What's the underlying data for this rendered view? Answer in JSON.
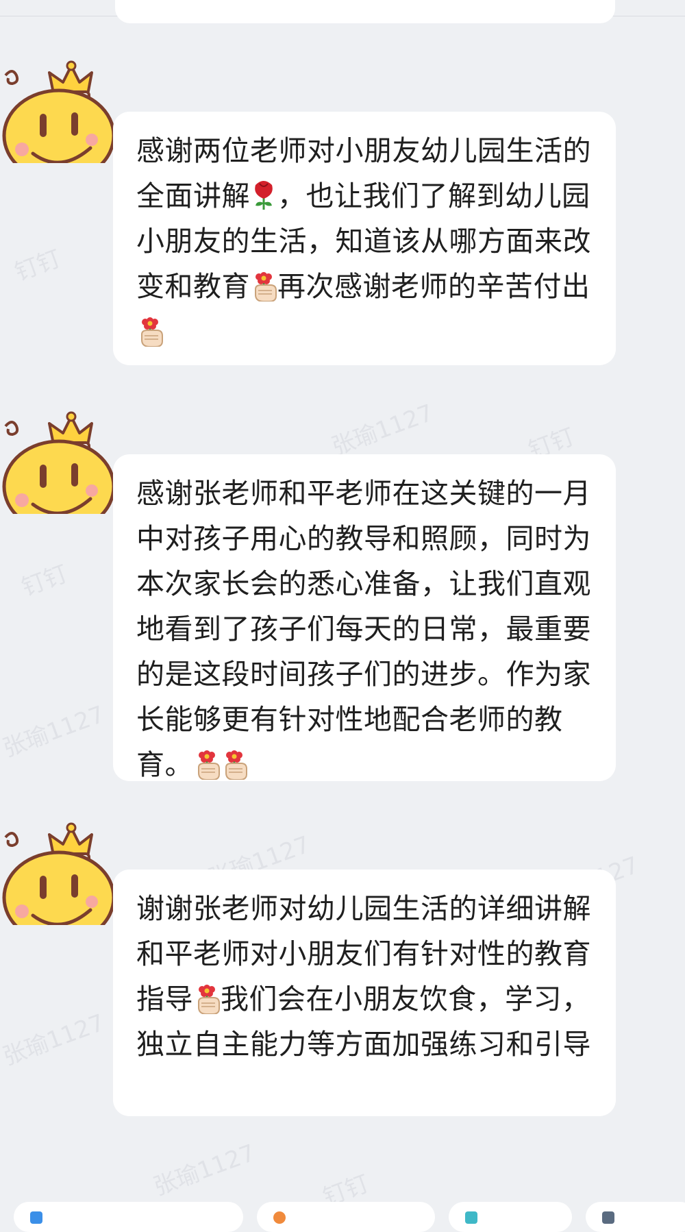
{
  "messages": [
    {
      "segments": [
        {
          "t": "感谢两位老师对小朋友幼儿园生活的全面讲解"
        },
        {
          "emoji": "rose-emoji"
        },
        {
          "t": "，也让我们了解到幼儿园小朋友的生活，知道该从哪方面来改变和教育"
        },
        {
          "emoji": "hand-flower-emoji"
        },
        {
          "t": "再次感谢老师的辛苦付出"
        },
        {
          "emoji": "hand-flower-emoji"
        }
      ]
    },
    {
      "segments": [
        {
          "t": "感谢张老师和平老师在这关键的一月中对孩子用心的教导和照顾，同时为本次家长会的悉心准备，让我们直观地看到了孩子们每天的日常，最重要的是这段时间孩子们的进步。作为家长能够更有针对性地配合老师的教育。"
        },
        {
          "emoji": "hand-flower-emoji"
        },
        {
          "emoji": "hand-flower-emoji"
        }
      ]
    },
    {
      "segments": [
        {
          "t": "谢谢张老师对幼儿园生活的详细讲解和平老师对小朋友们有针对性的教育指导"
        },
        {
          "emoji": "hand-flower-emoji"
        },
        {
          "t": "我们会在小朋友饮食，学习，独立自主能力等方面加强练习和引导"
        }
      ]
    }
  ],
  "watermark": {
    "texts": [
      "钉钉",
      "张瑜1127"
    ],
    "color": "#a0a8b4"
  },
  "avatar": {
    "icon": "smiley-crown-avatar-icon",
    "face_color": "#fdd94f",
    "crown_color": "#ffd23f",
    "outline_color": "#7a3e2d"
  },
  "colors": {
    "background": "#eef0f3",
    "bubble": "#ffffff",
    "text": "#1f1f1f"
  }
}
